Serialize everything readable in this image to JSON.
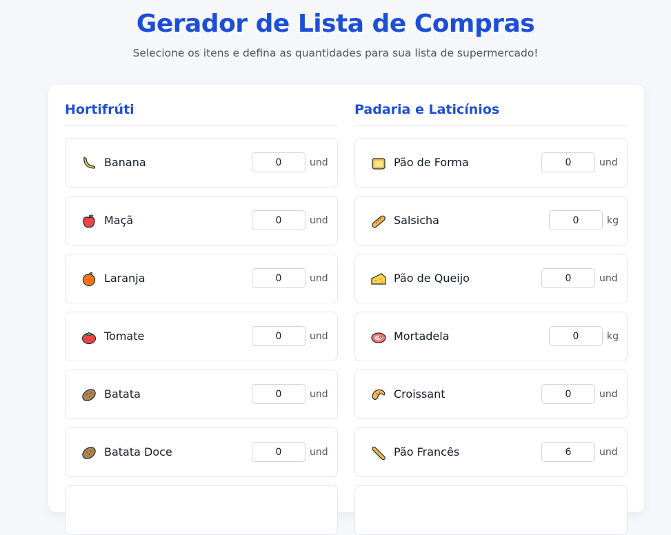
{
  "header": {
    "title": "Gerador de Lista de Compras",
    "subtitle": "Selecione os itens e defina as quantidades para sua lista de supermercado!"
  },
  "columns": [
    {
      "heading": "Hortifrúti",
      "items": [
        {
          "icon": "banana-icon",
          "name": "Banana",
          "qty": "0",
          "unit": "und"
        },
        {
          "icon": "apple-icon",
          "name": "Maçã",
          "qty": "0",
          "unit": "und"
        },
        {
          "icon": "orange-icon",
          "name": "Laranja",
          "qty": "0",
          "unit": "und"
        },
        {
          "icon": "tomato-icon",
          "name": "Tomate",
          "qty": "0",
          "unit": "und"
        },
        {
          "icon": "potato-icon",
          "name": "Batata",
          "qty": "0",
          "unit": "und"
        },
        {
          "icon": "sweet-potato-icon",
          "name": "Batata Doce",
          "qty": "0",
          "unit": "und"
        }
      ]
    },
    {
      "heading": "Padaria e Laticínios",
      "items": [
        {
          "icon": "bread-loaf-icon",
          "name": "Pão de Forma",
          "qty": "0",
          "unit": "und"
        },
        {
          "icon": "sausage-icon",
          "name": "Salsicha",
          "qty": "0",
          "unit": "kg"
        },
        {
          "icon": "cheese-icon",
          "name": "Pão de Queijo",
          "qty": "0",
          "unit": "und"
        },
        {
          "icon": "meat-icon",
          "name": "Mortadela",
          "qty": "0",
          "unit": "kg"
        },
        {
          "icon": "croissant-icon",
          "name": "Croissant",
          "qty": "0",
          "unit": "und"
        },
        {
          "icon": "baguette-icon",
          "name": "Pão Francês",
          "qty": "6",
          "unit": "und"
        }
      ]
    }
  ],
  "colors": {
    "accent": "#1d4ed8",
    "background": "#f5f7fb"
  }
}
